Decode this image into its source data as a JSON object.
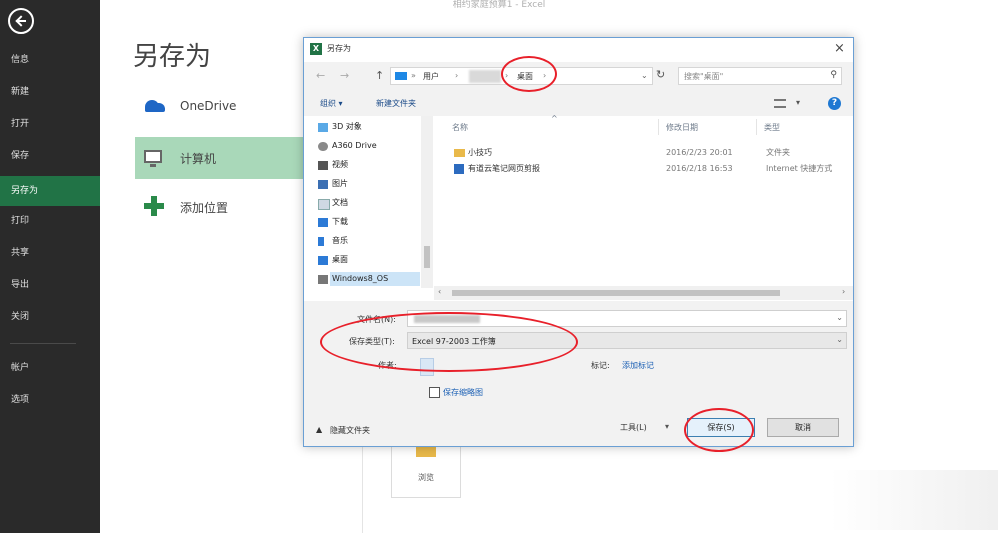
{
  "caption": "相约家庭预算1 - Excel",
  "sidebar": {
    "items": [
      {
        "label": "信息",
        "active": false
      },
      {
        "label": "新建",
        "active": false
      },
      {
        "label": "打开",
        "active": false
      },
      {
        "label": "保存",
        "active": false
      },
      {
        "label": "另存为",
        "active": true
      },
      {
        "label": "打印",
        "active": false
      },
      {
        "label": "共享",
        "active": false
      },
      {
        "label": "导出",
        "active": false
      },
      {
        "label": "关闭",
        "active": false
      }
    ],
    "bottom_items": [
      {
        "label": "帐户"
      },
      {
        "label": "选项"
      }
    ]
  },
  "backstage": {
    "title": "另存为",
    "locations": [
      {
        "label": "OneDrive",
        "icon": "onedrive-icon",
        "selected": false
      },
      {
        "label": "计算机",
        "icon": "computer-icon",
        "selected": true
      },
      {
        "label": "添加位置",
        "icon": "plus-icon",
        "selected": false
      }
    ],
    "browse_label": "浏览"
  },
  "dialog": {
    "title": "另存为",
    "close": "×",
    "nav": {
      "back": "←",
      "forward": "→",
      "up": "↑"
    },
    "address": {
      "seg1": "用户",
      "seg3": "桌面"
    },
    "search_placeholder": "搜索\"桌面\"",
    "toolbar": {
      "organize": "组织 ▾",
      "new_folder": "新建文件夹"
    },
    "tree": [
      {
        "label": "3D 对象",
        "icon": "cube-icon"
      },
      {
        "label": "A360 Drive",
        "icon": "cloud-icon"
      },
      {
        "label": "视频",
        "icon": "video-icon"
      },
      {
        "label": "图片",
        "icon": "picture-icon"
      },
      {
        "label": "文档",
        "icon": "document-icon"
      },
      {
        "label": "下载",
        "icon": "download-icon"
      },
      {
        "label": "音乐",
        "icon": "music-icon"
      },
      {
        "label": "桌面",
        "icon": "desktop-icon"
      },
      {
        "label": "Windows8_OS",
        "icon": "drive-icon",
        "selected": true
      }
    ],
    "columns": {
      "name": "名称",
      "date": "修改日期",
      "type": "类型"
    },
    "files": [
      {
        "name": "小技巧",
        "date": "2016/2/23 20:01",
        "type": "文件夹",
        "icon": "folder-icon"
      },
      {
        "name": "有道云笔记网页剪报",
        "date": "2016/2/18 16:53",
        "type": "Internet 快捷方式",
        "icon": "shortcut-icon"
      }
    ],
    "filename_label": "文件名(N):",
    "filetype_label": "保存类型(T):",
    "filetype_value": "Excel 97-2003 工作簿",
    "authors_label": "作者:",
    "tags_label": "标记:",
    "tags_add": "添加标记",
    "thumbnail_label": "保存缩略图",
    "hide_folders": "隐藏文件夹",
    "tools_label": "工具(L)",
    "save_button": "保存(S)",
    "cancel_button": "取消"
  },
  "annotation_color": "#e8202a",
  "accent_color": "#217346"
}
